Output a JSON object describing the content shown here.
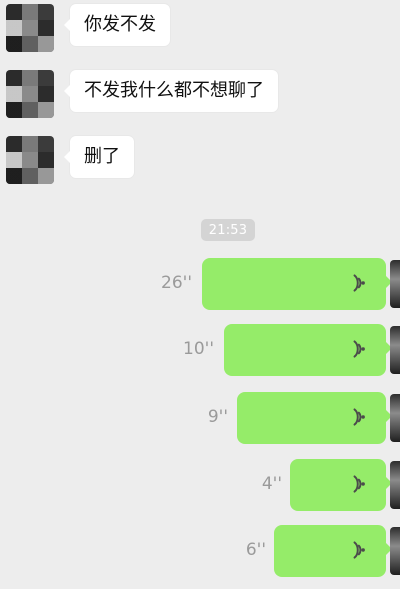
{
  "time_pill": "21:53",
  "messages_in": [
    {
      "text": "你发不发"
    },
    {
      "text": "不发我什么都不想聊了"
    },
    {
      "text": "删了"
    }
  ],
  "voice_messages": [
    {
      "duration": "26''"
    },
    {
      "duration": "10''"
    },
    {
      "duration": "9''"
    },
    {
      "duration": "4''"
    },
    {
      "duration": "6''"
    }
  ],
  "colors": {
    "background": "#ededed",
    "incoming_bubble": "#ffffff",
    "outgoing_bubble": "#95ec69",
    "duration_text": "#9a9a9a",
    "time_pill_bg": "#d4d4d4",
    "time_pill_text": "#ffffff"
  },
  "icons": {
    "voice": "voice-wave-icon"
  }
}
